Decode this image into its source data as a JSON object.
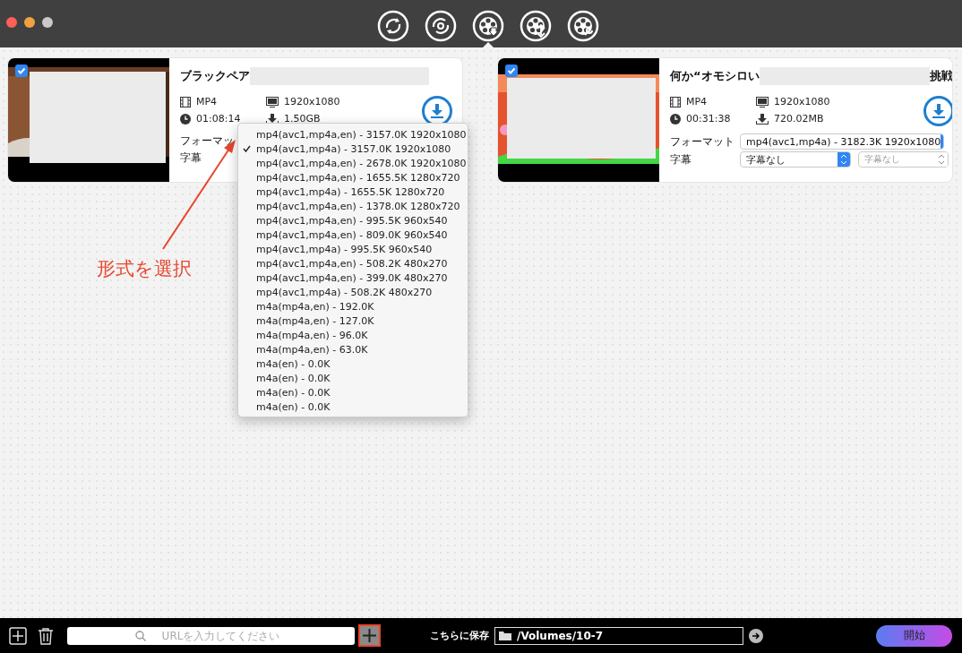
{
  "toolbar": {
    "tabs": [
      {
        "kind": "convert",
        "selected": false
      },
      {
        "kind": "record",
        "selected": false
      },
      {
        "kind": "download",
        "selected": true
      },
      {
        "kind": "edit",
        "selected": false
      },
      {
        "kind": "tools",
        "selected": false
      }
    ]
  },
  "videos": [
    {
      "checked": true,
      "title": "ブラックペア",
      "format": "MP4",
      "resolution": "1920x1080",
      "duration": "01:08:14",
      "size": "1.50GB",
      "format_label": "フォーマッ",
      "subtitle_label": "字幕"
    },
    {
      "checked": true,
      "title": "何か“オモシロい",
      "title_end": "挑戦",
      "format": "MP4",
      "resolution": "1920x1080",
      "duration": "00:31:38",
      "size": "720.02MB",
      "format_label": "フォーマット",
      "format_value": "mp4(avc1,mp4a) - 3182.3K 1920x1080",
      "subtitle_label": "字幕",
      "subtitle_selects": [
        {
          "value": "字幕なし",
          "disabled": false
        },
        {
          "value": "字幕なし",
          "disabled": true
        }
      ]
    }
  ],
  "format_menu": {
    "items": [
      {
        "label": "mp4(avc1,mp4a,en) - 3157.0K 1920x1080",
        "selected": false
      },
      {
        "label": "mp4(avc1,mp4a) - 3157.0K 1920x1080",
        "selected": true
      },
      {
        "label": "mp4(avc1,mp4a,en) - 2678.0K 1920x1080",
        "selected": false
      },
      {
        "label": "mp4(avc1,mp4a,en) - 1655.5K 1280x720",
        "selected": false
      },
      {
        "label": "mp4(avc1,mp4a) - 1655.5K 1280x720",
        "selected": false
      },
      {
        "label": "mp4(avc1,mp4a,en) - 1378.0K 1280x720",
        "selected": false
      },
      {
        "label": "mp4(avc1,mp4a,en) - 995.5K 960x540",
        "selected": false
      },
      {
        "label": "mp4(avc1,mp4a,en) - 809.0K 960x540",
        "selected": false
      },
      {
        "label": "mp4(avc1,mp4a) - 995.5K 960x540",
        "selected": false
      },
      {
        "label": "mp4(avc1,mp4a,en) - 508.2K 480x270",
        "selected": false
      },
      {
        "label": "mp4(avc1,mp4a,en) - 399.0K 480x270",
        "selected": false
      },
      {
        "label": "mp4(avc1,mp4a) - 508.2K 480x270",
        "selected": false
      },
      {
        "label": "m4a(mp4a,en) - 192.0K",
        "selected": false
      },
      {
        "label": "m4a(mp4a,en) - 127.0K",
        "selected": false
      },
      {
        "label": "m4a(mp4a,en) - 96.0K",
        "selected": false
      },
      {
        "label": "m4a(mp4a,en) - 63.0K",
        "selected": false
      },
      {
        "label": "m4a(en) - 0.0K",
        "selected": false
      },
      {
        "label": "m4a(en) - 0.0K",
        "selected": false
      },
      {
        "label": "m4a(en) - 0.0K",
        "selected": false
      },
      {
        "label": "m4a(en) - 0.0K",
        "selected": false
      }
    ]
  },
  "annotation": {
    "text": "形式を選択"
  },
  "bottom_bar": {
    "url_placeholder": "URLを入力してください",
    "save_label": "こちらに保存",
    "save_path": "/Volumes/10-7",
    "start_button": "開始"
  }
}
